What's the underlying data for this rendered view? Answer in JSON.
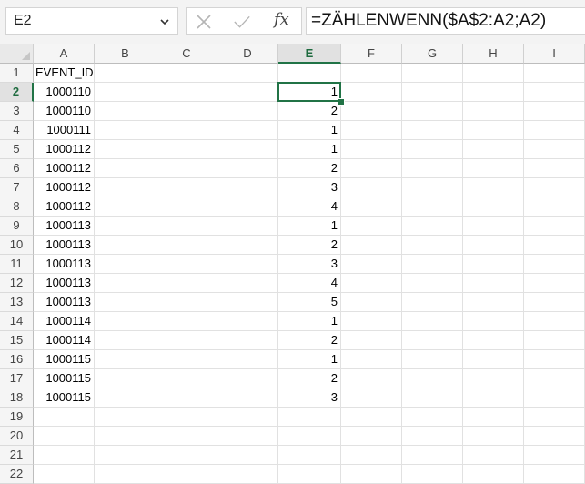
{
  "name_box": {
    "value": "E2"
  },
  "formula_bar": {
    "cancel_icon": "close-icon",
    "enter_icon": "checkmark-icon",
    "fx_label": "fx",
    "formula": "=ZÄHLENWENN($A$2:A2;A2)"
  },
  "columns": [
    "A",
    "B",
    "C",
    "D",
    "E",
    "F",
    "G",
    "H",
    "I"
  ],
  "selected_column": "E",
  "selected_row": "2",
  "rows": [
    {
      "num": "1",
      "A": "EVENT_ID",
      "E": ""
    },
    {
      "num": "2",
      "A": "1000110",
      "E": "1"
    },
    {
      "num": "3",
      "A": "1000110",
      "E": "2"
    },
    {
      "num": "4",
      "A": "1000111",
      "E": "1"
    },
    {
      "num": "5",
      "A": "1000112",
      "E": "1"
    },
    {
      "num": "6",
      "A": "1000112",
      "E": "2"
    },
    {
      "num": "7",
      "A": "1000112",
      "E": "3"
    },
    {
      "num": "8",
      "A": "1000112",
      "E": "4"
    },
    {
      "num": "9",
      "A": "1000113",
      "E": "1"
    },
    {
      "num": "10",
      "A": "1000113",
      "E": "2"
    },
    {
      "num": "11",
      "A": "1000113",
      "E": "3"
    },
    {
      "num": "12",
      "A": "1000113",
      "E": "4"
    },
    {
      "num": "13",
      "A": "1000113",
      "E": "5"
    },
    {
      "num": "14",
      "A": "1000114",
      "E": "1"
    },
    {
      "num": "15",
      "A": "1000114",
      "E": "2"
    },
    {
      "num": "16",
      "A": "1000115",
      "E": "1"
    },
    {
      "num": "17",
      "A": "1000115",
      "E": "2"
    },
    {
      "num": "18",
      "A": "1000115",
      "E": "3"
    },
    {
      "num": "19",
      "A": "",
      "E": ""
    },
    {
      "num": "20",
      "A": "",
      "E": ""
    },
    {
      "num": "21",
      "A": "",
      "E": ""
    },
    {
      "num": "22",
      "A": "",
      "E": ""
    }
  ],
  "colors": {
    "accent": "#217346",
    "header_bg": "#f5f5f5",
    "gridline": "#e1e1e1"
  }
}
